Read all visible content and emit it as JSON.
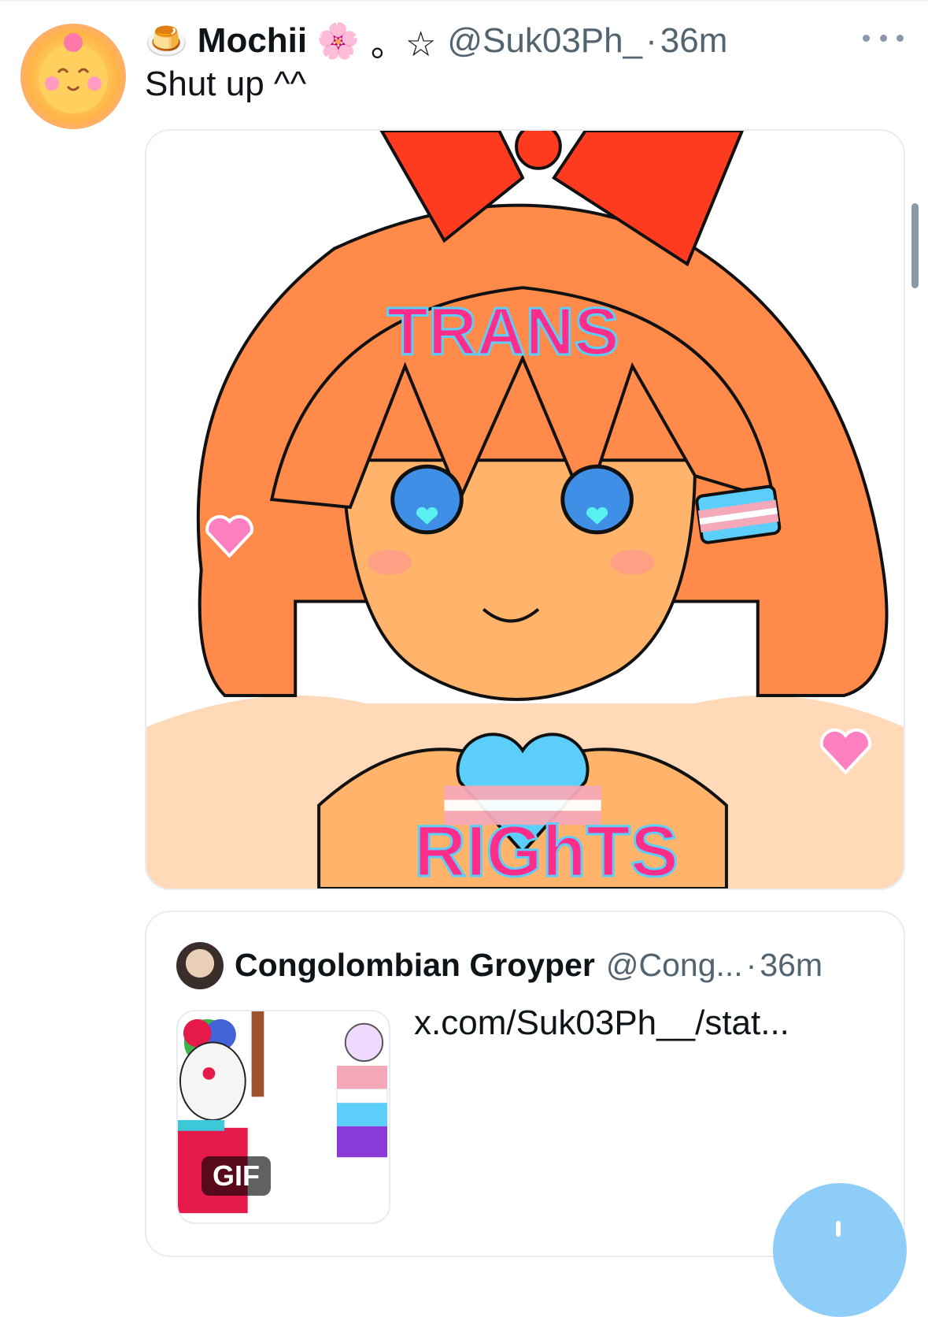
{
  "tweet": {
    "author_emoji": "🍮",
    "display_name": "Mochii",
    "name_flower": "🌸",
    "name_sparkle": "。☆",
    "handle": "@Suk03Ph_",
    "separator": "·",
    "time": "36m",
    "text": "Shut up  ^^",
    "image_text_top": "TRANS",
    "image_text_bottom": "RIGhTS"
  },
  "quote": {
    "display_name": "Congolombian Groyper",
    "handle": "@Cong...",
    "separator": "·",
    "time": "36m",
    "link": "x.com/Suk03Ph__/stat...",
    "gif_label": "GIF"
  },
  "colors": {
    "accent": "#1d9bf0",
    "muted": "#536471",
    "trans_pink": "#f5a9b8",
    "trans_blue": "#5bcefa"
  },
  "icons": {
    "more": "more-horizontal-icon",
    "compose": "compose-fab-icon"
  }
}
